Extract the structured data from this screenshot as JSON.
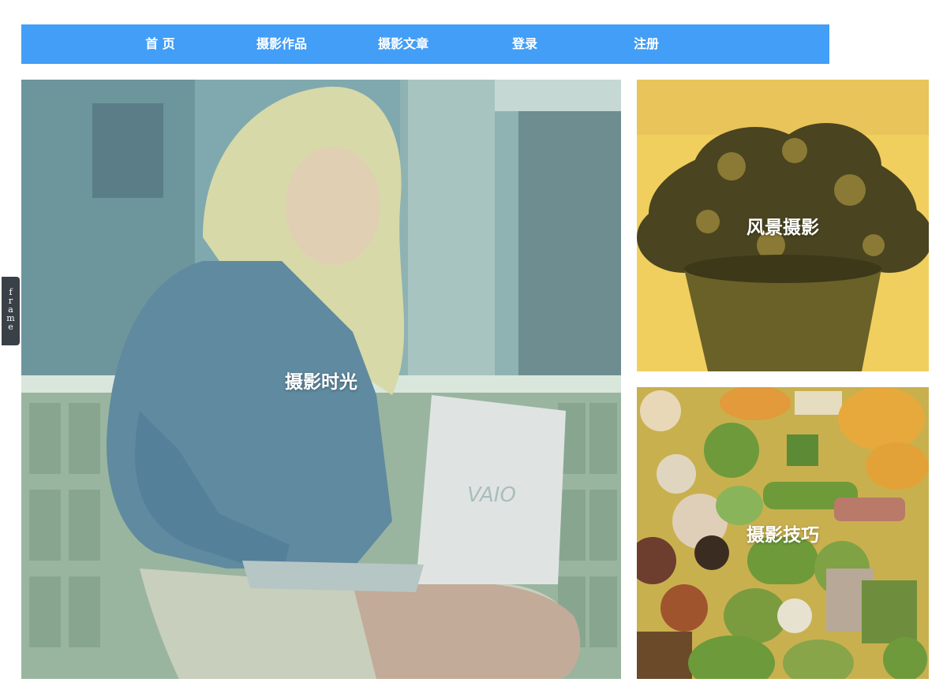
{
  "nav": {
    "items": [
      {
        "label": "首 页"
      },
      {
        "label": "摄影作品"
      },
      {
        "label": "摄影文章"
      },
      {
        "label": "登录"
      },
      {
        "label": "注册"
      }
    ],
    "background_color": "#429ef6"
  },
  "tiles": {
    "large": {
      "caption": "摄影时光",
      "tint_color": "#6e9ea8"
    },
    "top_right": {
      "caption": "风景摄影",
      "tint_color": "#f0cf5e"
    },
    "bottom_right": {
      "caption": "摄影技巧",
      "tint_color": "#c9b04f"
    }
  },
  "side_tab": {
    "label": "frame"
  },
  "photo_text": {
    "laptop_brand": "VAIO"
  }
}
